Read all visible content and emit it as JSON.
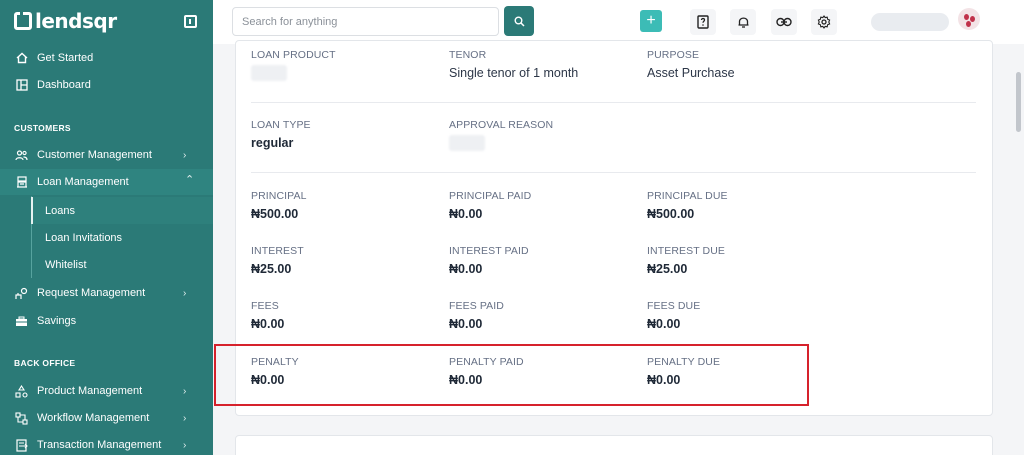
{
  "app": {
    "brand": "lendsqr"
  },
  "search": {
    "placeholder": "Search for anything"
  },
  "topbar": {
    "plus_label": "+"
  },
  "sidebar": {
    "top_items": [
      {
        "label": "Get Started"
      },
      {
        "label": "Dashboard"
      }
    ],
    "customers_title": "CUSTOMERS",
    "customer_items": [
      {
        "label": "Customer Management"
      },
      {
        "label": "Loan Management"
      }
    ],
    "loan_sub_items": [
      {
        "label": "Loans"
      },
      {
        "label": "Loan Invitations"
      },
      {
        "label": "Whitelist"
      }
    ],
    "more_items": [
      {
        "label": "Request Management"
      },
      {
        "label": "Savings"
      }
    ],
    "backoffice_title": "BACK OFFICE",
    "backoffice_items": [
      {
        "label": "Product Management"
      },
      {
        "label": "Workflow Management"
      },
      {
        "label": "Transaction Management"
      }
    ]
  },
  "details": {
    "loan_product": {
      "label": "LOAN PRODUCT"
    },
    "tenor": {
      "label": "TENOR",
      "value": "Single tenor of 1 month"
    },
    "purpose": {
      "label": "PURPOSE",
      "value": "Asset Purchase"
    },
    "loan_type": {
      "label": "LOAN TYPE",
      "value": "regular"
    },
    "approval_reason": {
      "label": "APPROVAL REASON"
    },
    "principal": {
      "label": "PRINCIPAL",
      "value": "₦500.00"
    },
    "principal_paid": {
      "label": "PRINCIPAL PAID",
      "value": "₦0.00"
    },
    "principal_due": {
      "label": "PRINCIPAL DUE",
      "value": "₦500.00"
    },
    "interest": {
      "label": "INTEREST",
      "value": "₦25.00"
    },
    "interest_paid": {
      "label": "INTEREST PAID",
      "value": "₦0.00"
    },
    "interest_due": {
      "label": "INTEREST DUE",
      "value": "₦25.00"
    },
    "fees": {
      "label": "FEES",
      "value": "₦0.00"
    },
    "fees_paid": {
      "label": "FEES PAID",
      "value": "₦0.00"
    },
    "fees_due": {
      "label": "FEES DUE",
      "value": "₦0.00"
    },
    "penalty": {
      "label": "PENALTY",
      "value": "₦0.00"
    },
    "penalty_paid": {
      "label": "PENALTY PAID",
      "value": "₦0.00"
    },
    "penalty_due": {
      "label": "PENALTY DUE",
      "value": "₦0.00"
    }
  },
  "colors": {
    "sidebar_bg": "#2b7a77",
    "accent": "#3cbcb6",
    "highlight": "#d6222c"
  }
}
